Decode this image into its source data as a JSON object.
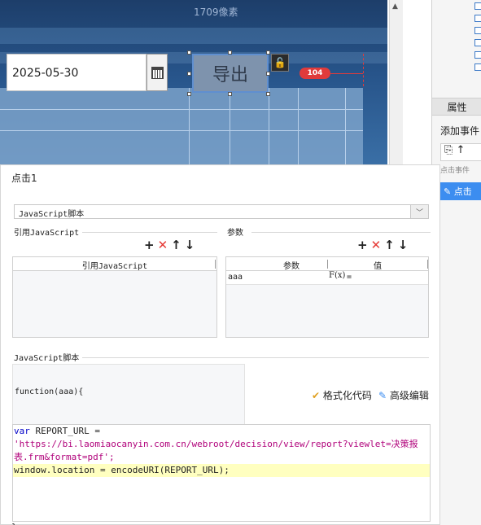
{
  "canvas": {
    "top_label": "1709像素",
    "date_value": "2025-05-30",
    "export_label": "导出",
    "lock_glyph": "🔓",
    "badge": "104"
  },
  "right_panel": {
    "tab_label": "属性",
    "add_event_label": "添加事件",
    "toolbar_glyphs": "⎘ ↑",
    "event_hint": "点击事件",
    "selected_item": "点击"
  },
  "dialog": {
    "title": "点击1",
    "type_select": "JavaScript脚本",
    "ref_js_group": "引用JavaScript",
    "params_group": "参数",
    "ref_js_col": "引用JavaScript",
    "param_col": "参数",
    "value_col": "值",
    "param_rows": [
      {
        "name": "aaa",
        "fx": "F(x)",
        "value": "="
      }
    ],
    "script_group": "JavaScript脚本",
    "signature": "function(aaa){",
    "format_btn": "格式化代码",
    "advanced_btn": "高级编辑",
    "code": {
      "line1_kw": "var",
      "line1_rest": " REPORT_URL =",
      "line2": "'https://bi.laomiaocanyin.com.cn/webroot/decision/view/report?viewlet=决策报",
      "line3": "表.frm&format=pdf';",
      "line4": "window.location = encodeURI(REPORT_URL);"
    },
    "closing": "}"
  },
  "colors": {
    "accent": "#3c8df0",
    "delete": "#e53935",
    "badge": "#e03b3b",
    "keyword": "#0000c8",
    "string": "#b0007a",
    "highlight_line": "#ffffc0"
  }
}
